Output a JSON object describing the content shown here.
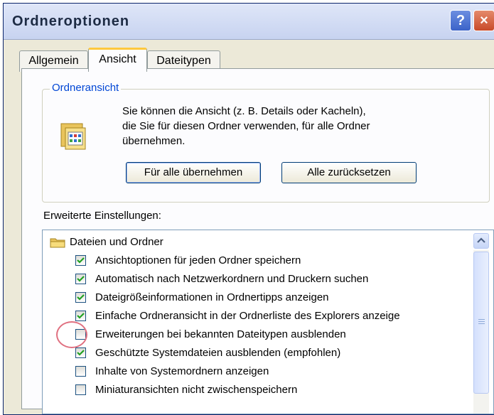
{
  "window": {
    "title": "Ordneroptionen",
    "help_label": "?",
    "close_label": "×"
  },
  "tabs": [
    {
      "label": "Allgemein",
      "active": false
    },
    {
      "label": "Ansicht",
      "active": true
    },
    {
      "label": "Dateitypen",
      "active": false
    }
  ],
  "folder_view": {
    "legend": "Ordneransicht",
    "description_lines": [
      "Sie können die Ansicht (z. B. Details oder Kacheln),",
      "die Sie für diesen Ordner verwenden, für alle Ordner",
      "übernehmen."
    ],
    "apply_all_label": "Für alle übernehmen",
    "reset_all_label": "Alle zurücksetzen"
  },
  "advanced": {
    "label": "Erweiterte Einstellungen:",
    "category": "Dateien und Ordner",
    "items": [
      {
        "label": "Ansichtoptionen für jeden Ordner speichern",
        "checked": true
      },
      {
        "label": "Automatisch nach Netzwerkordnern und Druckern suchen",
        "checked": true
      },
      {
        "label": "Dateigrößeinformationen in Ordnertipps anzeigen",
        "checked": true
      },
      {
        "label": "Einfache Ordneransicht in der Ordnerliste des Explorers anzeige",
        "checked": true
      },
      {
        "label": "Erweiterungen bei bekannten Dateitypen ausblenden",
        "checked": false
      },
      {
        "label": "Geschützte Systemdateien ausblenden (empfohlen)",
        "checked": true
      },
      {
        "label": "Inhalte von Systemordnern anzeigen",
        "checked": false
      },
      {
        "label": "Miniaturansichten nicht zwischenspeichern",
        "checked": false
      }
    ]
  },
  "colors": {
    "check": "#21a121",
    "legend": "#0046d5",
    "highlight": "#e07080"
  }
}
